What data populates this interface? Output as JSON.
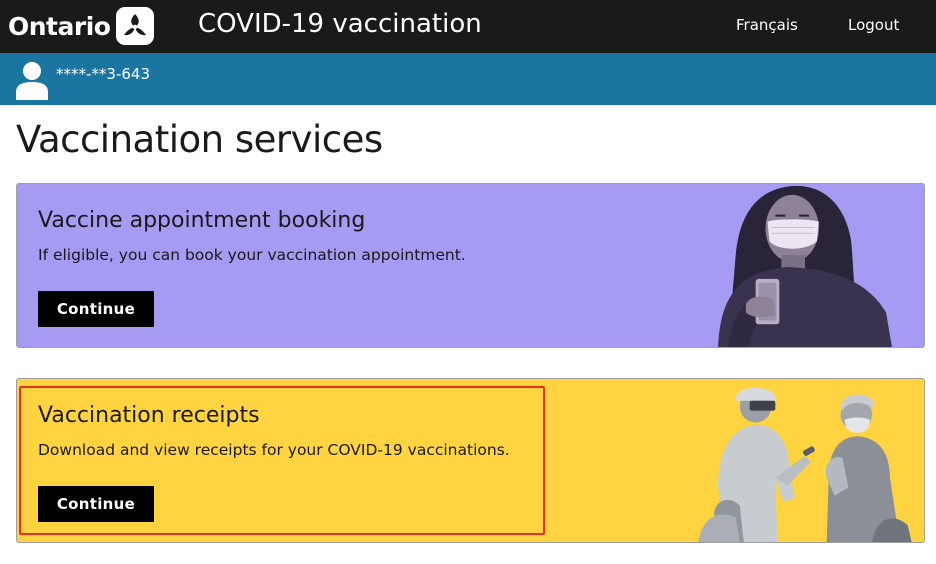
{
  "header": {
    "brand": "Ontario",
    "app_title": "COVID-19 vaccination",
    "language_link": "Français",
    "logout_link": "Logout"
  },
  "user_bar": {
    "masked_id": "****-**3-643"
  },
  "main": {
    "page_title": "Vaccination services",
    "cards": [
      {
        "title": "Vaccine appointment booking",
        "description": "If eligible, you can book your vaccination appointment.",
        "button_label": "Continue",
        "bg_color": "#a59bf2",
        "image": "woman-with-mask-using-phone-photo"
      },
      {
        "title": "Vaccination receipts",
        "description": "Download and view receipts for your COVID-19 vaccinations.",
        "button_label": "Continue",
        "bg_color": "#ffd440",
        "image": "healthcare-worker-vaccinating-patient-photo"
      }
    ]
  },
  "colors": {
    "header_bg": "#1a1a1a",
    "user_bar_bg": "#1a76a1",
    "highlight_border": "#e8311e"
  }
}
